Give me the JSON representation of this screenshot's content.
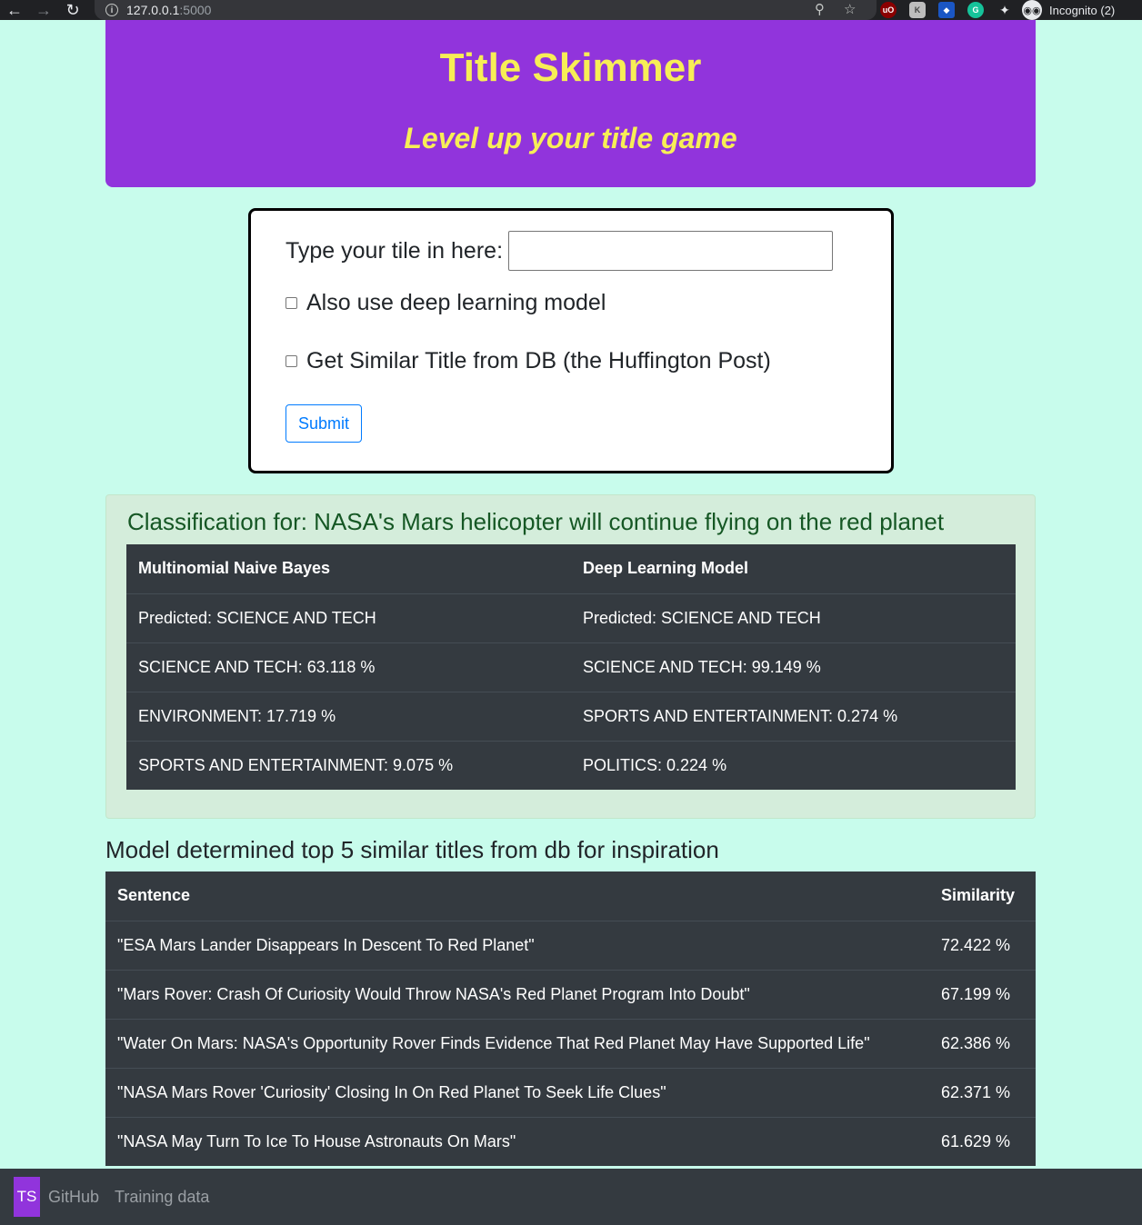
{
  "browser": {
    "url_host": "127.0.0.1",
    "url_port": ":5000",
    "profile_label": "Incognito (2)",
    "extensions": [
      "ublock-icon",
      "extension-icon",
      "shield-extension-icon",
      "grammarly-icon",
      "puzzle-icon"
    ]
  },
  "header": {
    "title": "Title Skimmer",
    "subtitle": "Level up your title game"
  },
  "form": {
    "input_label": "Type your tile in here:",
    "input_value": "",
    "deep_learning_label": "Also use deep learning model",
    "similar_title_label": "Get Similar Title from DB (the Huffington Post)",
    "submit_label": "Submit"
  },
  "classification": {
    "heading": "Classification for: NASA's Mars helicopter will continue flying on the red planet",
    "columns": [
      "Multinomial Naive Bayes",
      "Deep Learning Model"
    ],
    "rows": [
      [
        "Predicted: SCIENCE AND TECH",
        "Predicted: SCIENCE AND TECH"
      ],
      [
        "SCIENCE AND TECH: 63.118 %",
        "SCIENCE AND TECH: 99.149 %"
      ],
      [
        "ENVIRONMENT: 17.719 %",
        "SPORTS AND ENTERTAINMENT: 0.274 %"
      ],
      [
        "SPORTS AND ENTERTAINMENT: 9.075 %",
        "POLITICS: 0.224 %"
      ]
    ]
  },
  "similar": {
    "heading": "Model determined top 5 similar titles from db for inspiration",
    "columns": [
      "Sentence",
      "Similarity"
    ],
    "rows": [
      [
        "\"ESA Mars Lander Disappears In Descent To Red Planet\"",
        "72.422 %"
      ],
      [
        "\"Mars Rover: Crash Of Curiosity Would Throw NASA's Red Planet Program Into Doubt\"",
        "67.199 %"
      ],
      [
        "\"Water On Mars: NASA's Opportunity Rover Finds Evidence That Red Planet May Have Supported Life\"",
        "62.386 %"
      ],
      [
        "\"NASA Mars Rover 'Curiosity' Closing In On Red Planet To Seek Life Clues\"",
        "62.371 %"
      ],
      [
        "\"NASA May Turn To Ice To House Astronauts On Mars\"",
        "61.629 %"
      ]
    ]
  },
  "footer": {
    "brand": "TS",
    "links": [
      "GitHub",
      "Training data"
    ]
  },
  "colors": {
    "page_bg": "#c8fcec",
    "hero_bg": "#9134dc",
    "hero_text": "#f7ee56",
    "table_bg": "#343a40",
    "alert_bg": "#d4eddb",
    "alert_text": "#155724",
    "button_blue": "#007bff"
  }
}
